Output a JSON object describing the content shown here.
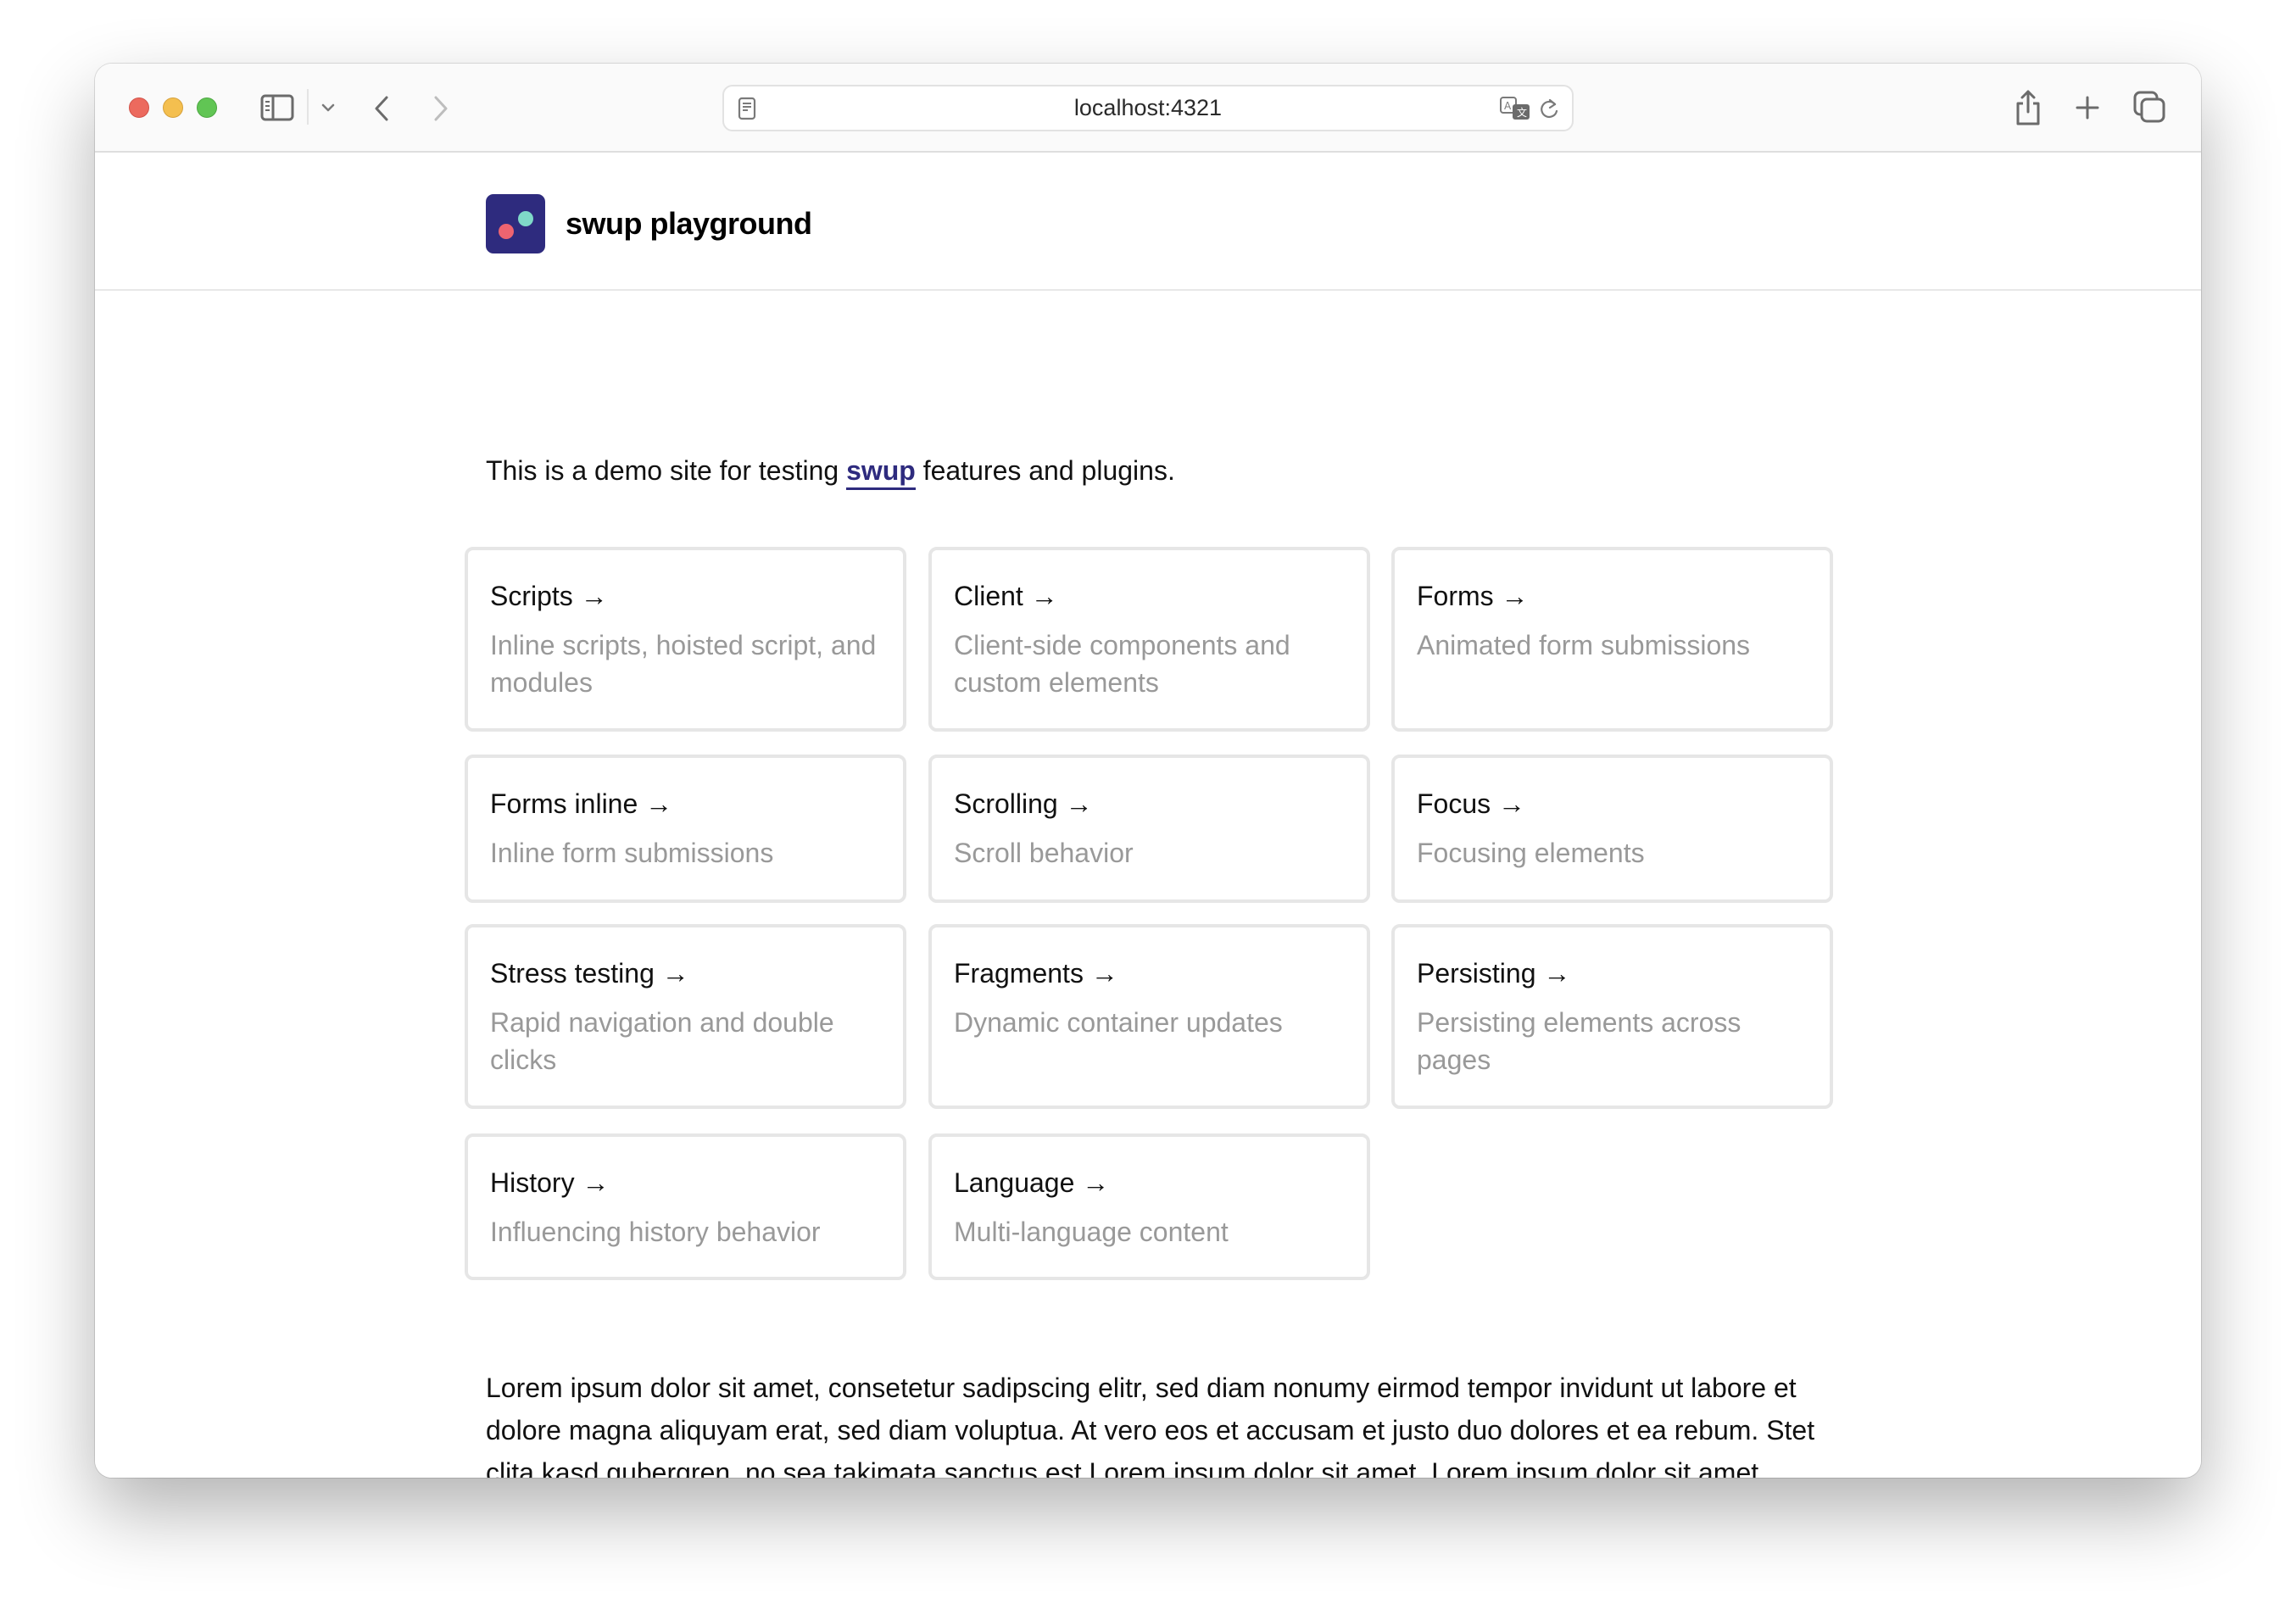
{
  "browser": {
    "url": "localhost:4321",
    "icons": {
      "close": "close-window",
      "minimize": "minimize-window",
      "zoom": "zoom-window",
      "sidebar": "sidebar-icon",
      "tab_group_menu": "chevron-down-icon",
      "back": "chevron-left-icon",
      "forward": "chevron-right-icon",
      "page": "page-menu-icon",
      "translate": "translate-icon",
      "reload": "reload-icon",
      "share": "share-icon",
      "new_tab": "plus-icon",
      "tab_overview": "tabs-overview-icon"
    }
  },
  "site": {
    "title": "swup playground",
    "brand_colors": {
      "logo_bg": "#2e2b7e",
      "logo_dot_teal": "#7fd9c8",
      "logo_dot_red": "#ee6470",
      "link": "#2e2b7e"
    }
  },
  "intro": {
    "before": "This is a demo site for testing ",
    "link": "swup",
    "after": " features and plugins."
  },
  "cards": [
    {
      "title": "Scripts →",
      "description": "Inline scripts, hoisted script, and modules"
    },
    {
      "title": "Client →",
      "description": "Client-side components and custom elements"
    },
    {
      "title": "Forms →",
      "description": "Animated form submissions"
    },
    {
      "title": "Forms inline →",
      "description": "Inline form submissions"
    },
    {
      "title": "Scrolling →",
      "description": "Scroll behavior"
    },
    {
      "title": "Focus →",
      "description": "Focusing elements"
    },
    {
      "title": "Stress testing →",
      "description": "Rapid navigation and double clicks"
    },
    {
      "title": "Fragments →",
      "description": "Dynamic container updates"
    },
    {
      "title": "Persisting →",
      "description": "Persisting elements across pages"
    },
    {
      "title": "History →",
      "description": "Influencing history behavior"
    },
    {
      "title": "Language →",
      "description": "Multi-language content"
    }
  ],
  "lorem": "Lorem ipsum dolor sit amet, consetetur sadipscing elitr, sed diam nonumy eirmod tempor invidunt ut labore et dolore magna aliquyam erat, sed diam voluptua. At vero eos et accusam et justo duo dolores et ea rebum. Stet clita kasd gubergren, no sea takimata sanctus est Lorem ipsum dolor sit amet. Lorem ipsum dolor sit amet, consetetur sadipscing elitr, sed diam nonumy eirmod tempor invidunt ut labore et dolore magna"
}
